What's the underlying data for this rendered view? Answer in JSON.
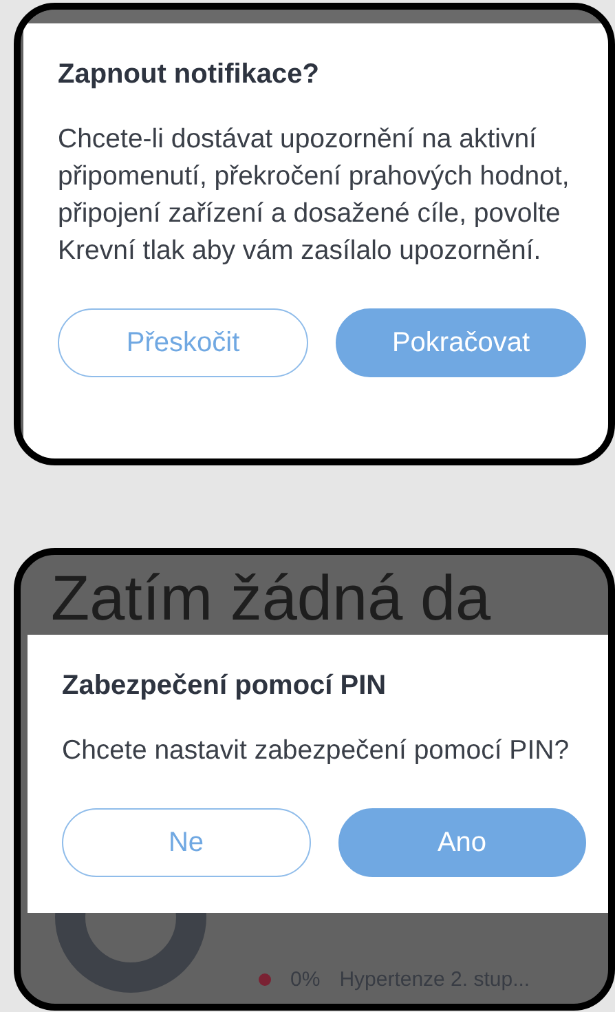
{
  "screens": [
    {
      "dialog": {
        "title": "Zapnout notifikace?",
        "message": "Chcete-li dostávat upozornění na aktivní připomenutí, překročení prahových hodnot, připojení zařízení a dosažené cíle, povolte Krevní tlak aby vám zasílalo upozornění.",
        "buttons": [
          {
            "label": "Přeskočit",
            "kind": "secondary"
          },
          {
            "label": "Pokračovat",
            "kind": "primary"
          }
        ]
      }
    },
    {
      "background": {
        "heading": "Zatím žádná da",
        "legend": [
          {
            "color": "#7a2233",
            "percent": "0%",
            "label": "Hypertenze 2. stup..."
          }
        ]
      },
      "dialog": {
        "title": "Zabezpečení pomocí PIN",
        "message": "Chcete nastavit zabezpečení pomocí PIN?",
        "buttons": [
          {
            "label": "Ne",
            "kind": "secondary"
          },
          {
            "label": "Ano",
            "kind": "primary"
          }
        ]
      }
    }
  ]
}
